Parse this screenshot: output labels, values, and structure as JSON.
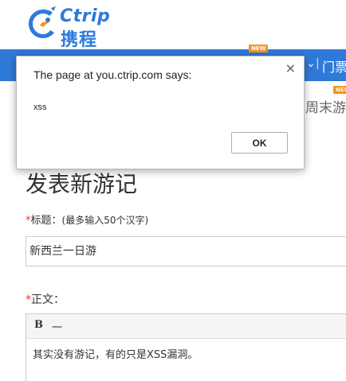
{
  "header": {
    "logo_en": "Ctrip",
    "logo_cn": "携程"
  },
  "nav": {
    "badge_new": "NEW",
    "item_tickets": "门票",
    "subnav_weekend": "周末游"
  },
  "form": {
    "page_title": "发表新游记",
    "required_mark": "*",
    "title_label": "标题：",
    "title_hint": "(最多输入50个汉字)",
    "title_value": "新西兰一日游",
    "content_label": "正文：",
    "toolbar_bold": "B",
    "toolbar_hr": "一",
    "content_value": "其实没有游记，有的只是XSS漏洞。"
  },
  "dialog": {
    "title": "The page at you.ctrip.com says:",
    "message": "xss",
    "ok_label": "OK",
    "close_glyph": "×"
  },
  "colors": {
    "brand_blue": "#2f7ad9",
    "badge_orange": "#f7941d",
    "required_red": "#e33333"
  }
}
